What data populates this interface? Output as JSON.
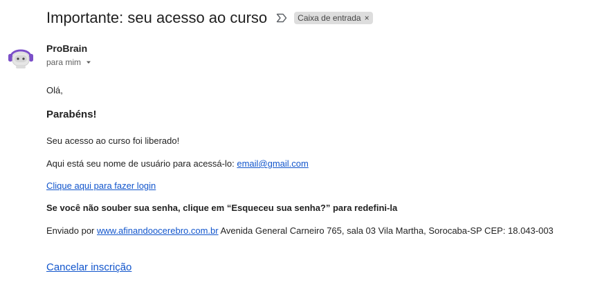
{
  "header": {
    "subject": "Importante: seu acesso ao curso",
    "label": "Caixa de entrada",
    "label_close": "×"
  },
  "sender": {
    "name": "ProBrain",
    "recipient": "para mim"
  },
  "body": {
    "greeting": "Olá,",
    "congrats": "Parabéns!",
    "released": "Seu acesso ao curso foi liberado!",
    "username_text": "Aqui está seu nome de usuário para acessá-lo: ",
    "username_link": "email@gmail.com",
    "login_link": "Clique aqui para fazer login",
    "password_note": "Se você não souber sua senha, clique em “Esqueceu sua senha?” para redefini-la",
    "sent_prefix": "Enviado por ",
    "sent_link": "www.afinandoocerebro.com.br",
    "sent_address": " Avenida General Carneiro 765, sala 03 Vila Martha, Sorocaba-SP CEP: 18.043-003",
    "unsubscribe": "Cancelar inscrição"
  },
  "colors": {
    "link": "#1155cc",
    "chip_bg": "#dddddd",
    "avatar_headphones": "#7b4fc8"
  },
  "icons": {
    "importance": "importance-marker-icon",
    "caret": "caret-down-icon",
    "avatar": "robot-avatar-icon"
  }
}
